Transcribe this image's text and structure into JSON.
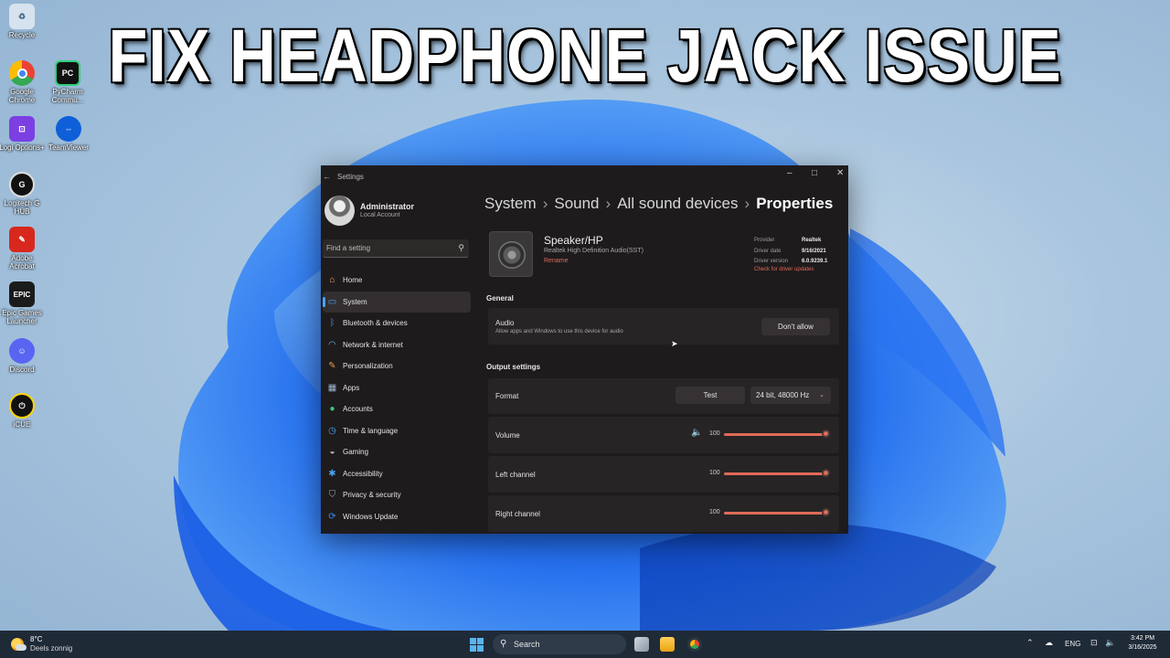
{
  "headline": "FIX HEADPHONE JACK ISSUE",
  "desktop_icons": [
    {
      "label": "Recycle",
      "icon": "recycle-bin-icon"
    },
    {
      "label": "Google Chrome",
      "icon": "chrome-icon"
    },
    {
      "label": "PyCharm Commu...",
      "icon": "pycharm-icon"
    },
    {
      "label": "Logi Options+",
      "icon": "logi-options-icon"
    },
    {
      "label": "TeamViewer",
      "icon": "teamviewer-icon"
    },
    {
      "label": "Logitech G HUB",
      "icon": "logitech-ghub-icon"
    },
    {
      "label": "Adobe Acrobat",
      "icon": "adobe-acrobat-icon"
    },
    {
      "label": "Epic Games Launcher",
      "icon": "epic-games-icon"
    },
    {
      "label": "Discord",
      "icon": "discord-icon"
    },
    {
      "label": "iCUE",
      "icon": "icue-icon"
    }
  ],
  "settings": {
    "window_title": "Settings",
    "user": {
      "name": "Administrator",
      "account": "Local Account"
    },
    "search_placeholder": "Find a setting",
    "nav": [
      {
        "label": "Home",
        "icon": "home-icon"
      },
      {
        "label": "System",
        "icon": "system-icon",
        "active": true
      },
      {
        "label": "Bluetooth & devices",
        "icon": "bluetooth-icon"
      },
      {
        "label": "Network & internet",
        "icon": "wifi-icon"
      },
      {
        "label": "Personalization",
        "icon": "brush-icon"
      },
      {
        "label": "Apps",
        "icon": "apps-icon"
      },
      {
        "label": "Accounts",
        "icon": "accounts-icon"
      },
      {
        "label": "Time & language",
        "icon": "clock-globe-icon"
      },
      {
        "label": "Gaming",
        "icon": "gamepad-icon"
      },
      {
        "label": "Accessibility",
        "icon": "accessibility-icon"
      },
      {
        "label": "Privacy & security",
        "icon": "shield-icon"
      },
      {
        "label": "Windows Update",
        "icon": "update-icon"
      }
    ],
    "breadcrumb": [
      "System",
      "Sound",
      "All sound devices",
      "Properties"
    ],
    "device": {
      "name": "Speaker/HP",
      "description": "Realtek High Definition Audio(SST)",
      "rename": "Rename",
      "provider_label": "Provider",
      "provider": "Realtek",
      "driver_date_label": "Driver date",
      "driver_date": "9/16/2021",
      "driver_version_label": "Driver version",
      "driver_version": "6.0.9239.1",
      "driver_updates_link": "Check for driver updates"
    },
    "general": {
      "title": "General",
      "audio_label": "Audio",
      "audio_desc": "Allow apps and Windows to use this device for audio",
      "dont_allow": "Don't allow"
    },
    "output": {
      "title": "Output settings",
      "format_label": "Format",
      "test": "Test",
      "format_value": "24 bit, 48000 Hz",
      "volume_label": "Volume",
      "volume": "100",
      "left_label": "Left channel",
      "left": "100",
      "right_label": "Right channel",
      "right": "100"
    }
  },
  "taskbar": {
    "temperature": "8°C",
    "condition": "Deels zonnig",
    "search": "Search",
    "language": "ENG",
    "time": "3:42 PM",
    "date": "3/16/2025"
  },
  "colors": {
    "accent": "#4aa3f0",
    "slider": "#e06b58",
    "window_bg": "#1e1b1c",
    "taskbar_bg": "#1f2a37"
  }
}
